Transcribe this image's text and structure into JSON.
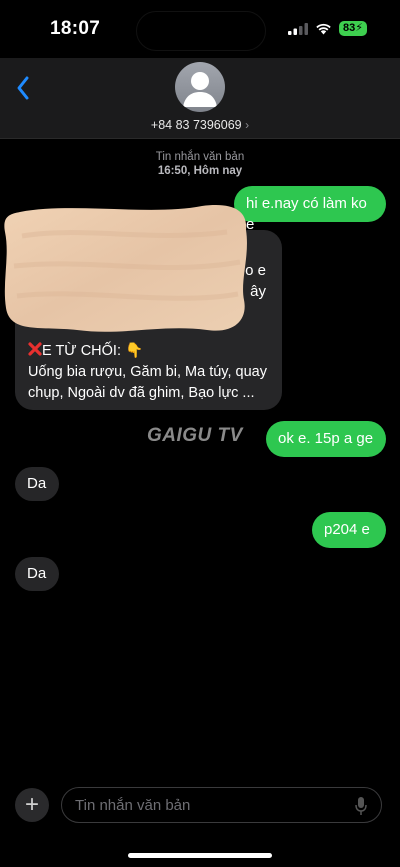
{
  "status": {
    "time": "18:07",
    "battery": "83"
  },
  "header": {
    "contact": "+84 83 7396069",
    "chevron": "›"
  },
  "meta": {
    "type": "Tin nhắn văn bản",
    "time": "16:50, Hôm nay"
  },
  "messages": {
    "m1": "hi e.nay có làm ko e",
    "m2_partial1": "o e",
    "m2_partial2": "ây",
    "m2_line1": "E TỪ CHỐI: ",
    "m2_line1_emoji": "👇",
    "m2_line2": "Uống bia rượu, Găm bi, Ma túy, quay chụp, Ngoài dv đã ghim, Bạo lực ...",
    "m3": "ok e. 15p a ge",
    "m4": "Da",
    "m5": "p204 e",
    "m6": "Da"
  },
  "watermark": "GAIGU TV",
  "composer": {
    "placeholder": "Tin nhắn văn bản",
    "plus": "+"
  },
  "colors": {
    "outgoing": "#2ec750",
    "incoming": "#262628",
    "accent": "#1f8bff"
  }
}
